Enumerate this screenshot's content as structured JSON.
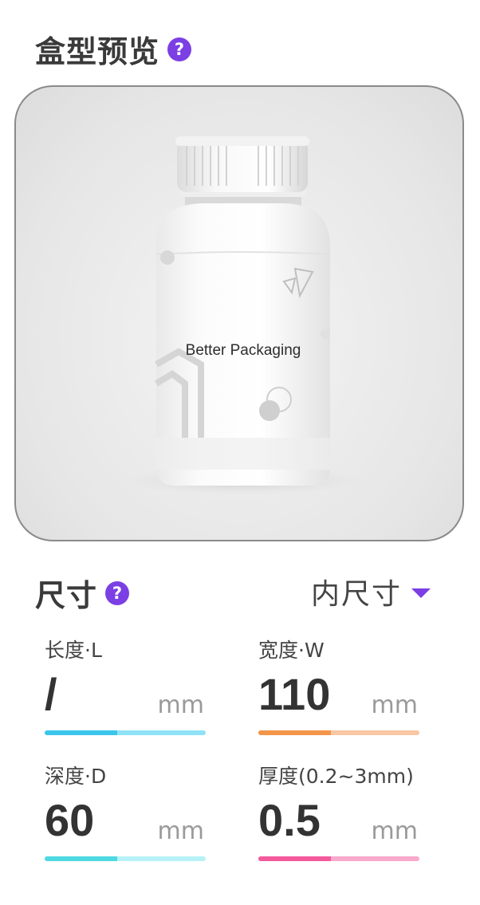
{
  "preview": {
    "title": "盒型预览",
    "help_glyph": "?",
    "bottle_label": "Better Packaging"
  },
  "size": {
    "title": "尺寸",
    "help_glyph": "?",
    "mode_selected": "内尺寸",
    "mode_arrow_icon": "caret-down-icon",
    "fields": [
      {
        "label": "长度·L",
        "value": "/",
        "unit": "mm",
        "color_main": "#3cc6ee",
        "color_light": "#8fe2f6",
        "fill_fraction": 0.45
      },
      {
        "label": "宽度·W",
        "value": "110",
        "unit": "mm",
        "color_main": "#f3954a",
        "color_light": "#f8c7a3",
        "fill_fraction": 0.45
      },
      {
        "label": "深度·D",
        "value": "60",
        "unit": "mm",
        "color_main": "#4fd9e2",
        "color_light": "#b6f2f5",
        "fill_fraction": 0.45
      },
      {
        "label": "厚度(0.2~3mm)",
        "value": "0.5",
        "unit": "mm",
        "color_main": "#f35a9c",
        "color_light": "#f9a9cc",
        "fill_fraction": 0.45
      }
    ]
  },
  "colors": {
    "accent": "#7b3fe4"
  }
}
